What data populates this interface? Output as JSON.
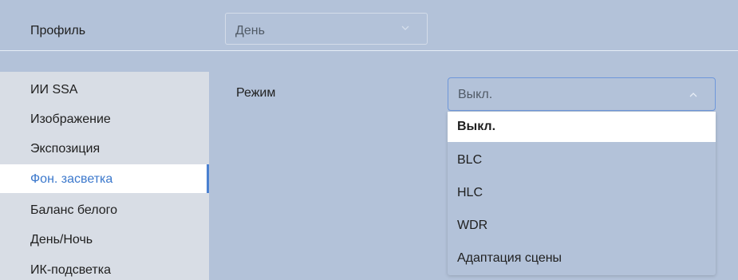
{
  "header": {
    "profile_label": "Профиль",
    "profile_value": "День"
  },
  "sidebar": {
    "items": [
      {
        "label": "ИИ SSA"
      },
      {
        "label": "Изображение"
      },
      {
        "label": "Экспозиция"
      },
      {
        "label": "Фон. засветка"
      },
      {
        "label": "Баланс белого"
      },
      {
        "label": "День/Ночь"
      },
      {
        "label": "ИК-подсветка"
      }
    ],
    "active_index": 3
  },
  "settings": {
    "mode_label": "Режим",
    "mode_value": "Выкл.",
    "options": [
      "Выкл.",
      "BLC",
      "HLC",
      "WDR",
      "Адаптация сцены"
    ],
    "selected_option": "Выкл."
  },
  "colors": {
    "accent": "#3b78cc",
    "background": "#b3c2d9",
    "sidebar": "#d8dde5"
  }
}
